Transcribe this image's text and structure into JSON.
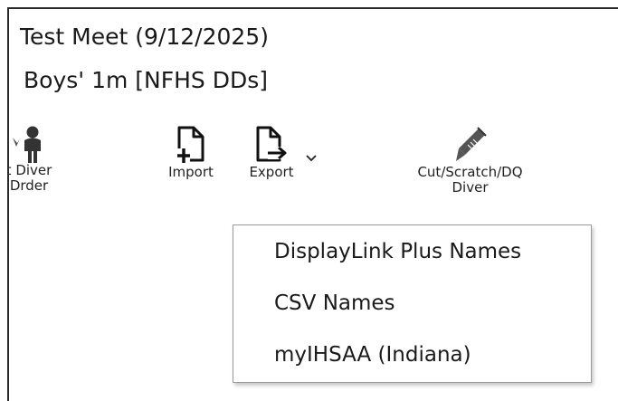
{
  "header": {
    "meet_title": "Test Meet (9/12/2025)",
    "event_title": "Boys' 1m [NFHS DDs]"
  },
  "toolbar": {
    "diver_order": {
      "line1": "t Diver",
      "line2": "Drder",
      "icon": "person-icon"
    },
    "import": {
      "label": "Import",
      "icon": "import-icon"
    },
    "export": {
      "label": "Export",
      "icon": "export-icon",
      "dropdown_icon": "chevron-down-icon"
    },
    "cut": {
      "line1": "Cut/Scratch/DQ",
      "line2": "Diver",
      "icon": "pen-icon"
    }
  },
  "export_menu": {
    "items": [
      "DisplayLink Plus Names",
      "CSV Names",
      "myIHSAA (Indiana)"
    ]
  }
}
